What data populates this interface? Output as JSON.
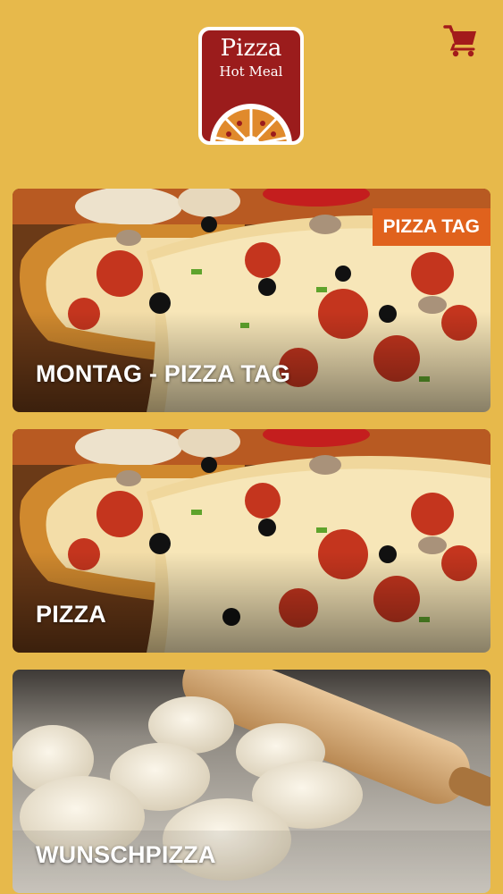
{
  "header": {
    "logo": {
      "title": "Pizza",
      "subtitle": "Hot Meal"
    },
    "cart_icon": "cart-icon",
    "colors": {
      "background": "#E7B94B",
      "logo_red": "#9B1C1C",
      "badge": "#E0621D"
    }
  },
  "categories": [
    {
      "title": "MONTAG - PIZZA TAG",
      "badge": "PIZZA TAG",
      "image": "pizza-slice-photo"
    },
    {
      "title": "PIZZA",
      "image": "pizza-slice-photo"
    },
    {
      "title": "WUNSCHPIZZA",
      "image": "pizza-dough-photo"
    }
  ]
}
